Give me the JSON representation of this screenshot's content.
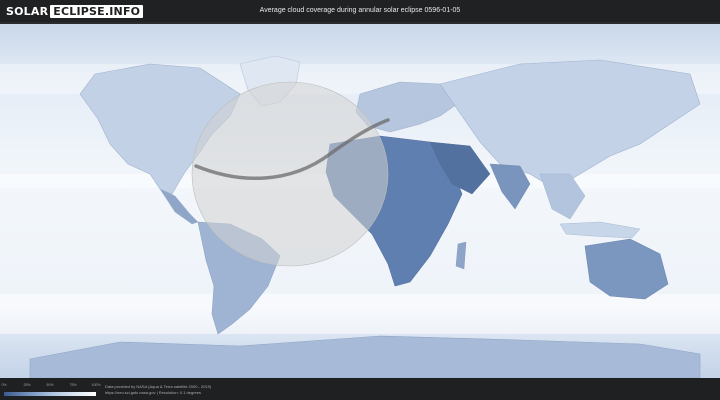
{
  "header": {
    "logo_part1": "SOLAR",
    "logo_part2": "ECLIPSE.INFO",
    "title": "Average cloud coverage during annular solar eclipse 0596-01-05"
  },
  "legend": {
    "ticks": [
      "0%",
      "25%",
      "50%",
      "75%",
      "100%"
    ]
  },
  "footer": {
    "credit_line1": "Data provided by NASA (Aqua & Terra satellite 2000 - 2019)",
    "credit_line2": "https://neo.sci.gsfc.nasa.gov | Resolution: 0.1 degrees"
  },
  "colors": {
    "ocean": "#eef3f9",
    "land_clear": "#4f6fa0",
    "eclipse_zone": "#cfcfcf",
    "path": "#6b6b6b"
  }
}
